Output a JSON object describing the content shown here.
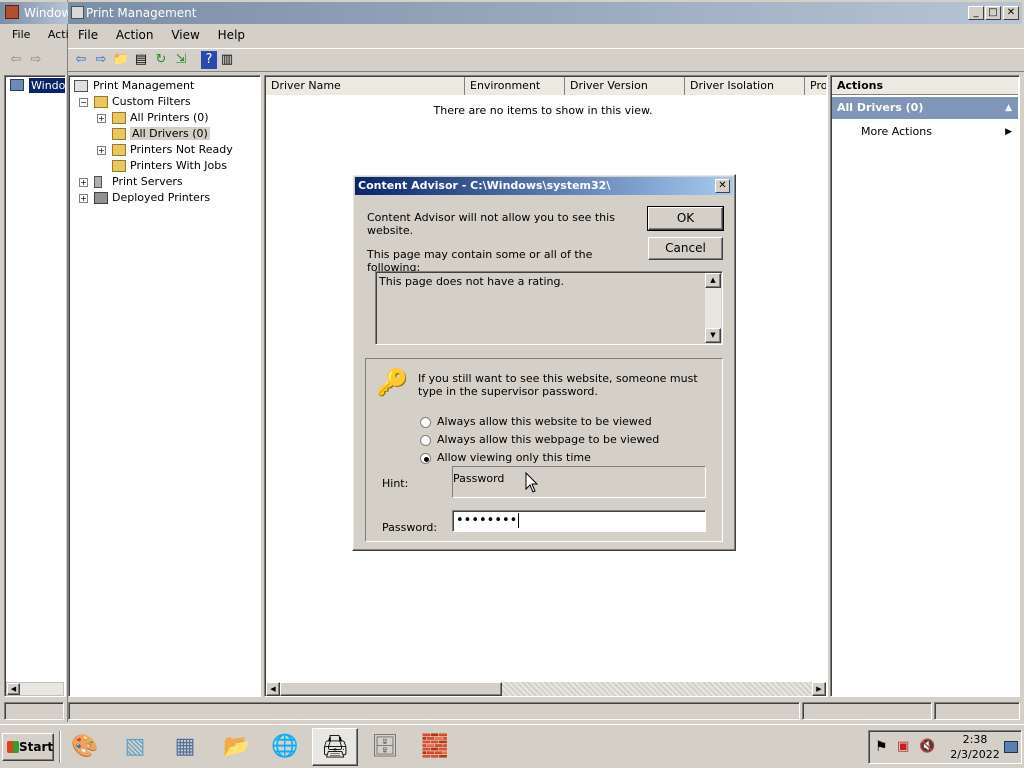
{
  "bg_window": {
    "title": "Window"
  },
  "main_window": {
    "title": "Print Management",
    "bg_menu": [
      "File",
      "Acti"
    ],
    "menu": [
      "File",
      "Action",
      "View",
      "Help"
    ]
  },
  "tree": {
    "root": "Print Management",
    "items": [
      {
        "label": "Custom Filters",
        "indent": 1,
        "expander": "-"
      },
      {
        "label": "All Printers (0)",
        "indent": 2,
        "expander": "+"
      },
      {
        "label": "All Drivers (0)",
        "indent": 2,
        "expander": ""
      },
      {
        "label": "Printers Not Ready",
        "indent": 2,
        "expander": "+"
      },
      {
        "label": "Printers With Jobs",
        "indent": 2,
        "expander": ""
      },
      {
        "label": "Print Servers",
        "indent": 1,
        "expander": "+"
      },
      {
        "label": "Deployed Printers",
        "indent": 1,
        "expander": "+"
      }
    ]
  },
  "list": {
    "columns": [
      "Driver Name",
      "Environment",
      "Driver Version",
      "Driver Isolation",
      "Pro"
    ],
    "empty_text": "There are no items to show in this view."
  },
  "actions": {
    "header": "Actions",
    "section": "All Drivers (0)",
    "more": "More Actions"
  },
  "dialog": {
    "title": "Content Advisor - C:\\Windows\\system32\\",
    "message": "Content Advisor will not allow you to see this website.",
    "ok": "OK",
    "cancel": "Cancel",
    "may_contain": "This page may contain some or all of the following:",
    "rating_text": "This page does not have a rating.",
    "supervisor_text": "If you still want to see this website, someone must type in the supervisor password.",
    "options": [
      {
        "label": "Always allow this website to be viewed",
        "checked": false
      },
      {
        "label": "Always allow this webpage to be viewed",
        "checked": false
      },
      {
        "label": "Allow viewing only this time",
        "checked": true
      }
    ],
    "hint_label": "Hint:",
    "hint_value": "Password",
    "password_label": "Password:",
    "password_value": "••••••••"
  },
  "taskbar": {
    "start": "Start",
    "time": "2:38",
    "date": "2/3/2022"
  },
  "colors": {
    "selection": "#0a246a",
    "actions_section": "#7f96b8"
  }
}
